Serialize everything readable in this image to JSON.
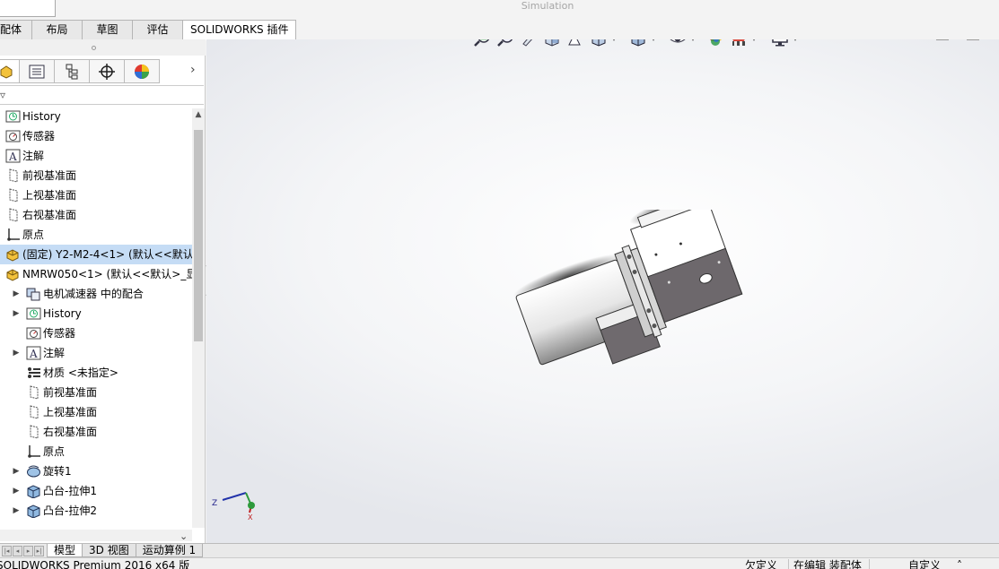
{
  "title_bar": {
    "simulation_label": "Simulation"
  },
  "ribbon": {
    "tabs": [
      {
        "label": "装配体",
        "display": "装配体"
      },
      {
        "label": "布局"
      },
      {
        "label": "草图"
      },
      {
        "label": "评估"
      },
      {
        "label": "SOLIDWORKS 插件",
        "active": true
      }
    ]
  },
  "feature_manager": {
    "panel_tabs": [
      "feature-manager-icon",
      "property-manager-icon",
      "configuration-manager-icon",
      "dimxpert-icon",
      "display-manager-icon"
    ],
    "tree": [
      {
        "label": "History",
        "icon": "history-icon",
        "level": 0,
        "expander": false
      },
      {
        "label": "传感器",
        "icon": "sensor-icon",
        "level": 0,
        "expander": false
      },
      {
        "label": "注解",
        "icon": "annotation-icon",
        "level": 0,
        "expander": false
      },
      {
        "label": "前视基准面",
        "icon": "plane-icon",
        "level": 0,
        "expander": false
      },
      {
        "label": "上视基准面",
        "icon": "plane-icon",
        "level": 0,
        "expander": false
      },
      {
        "label": "右视基准面",
        "icon": "plane-icon",
        "level": 0,
        "expander": false
      },
      {
        "label": "原点",
        "icon": "origin-icon",
        "level": 0,
        "expander": false
      },
      {
        "label": "(固定) Y2-M2-4<1> (默认<<默认",
        "icon": "part-icon",
        "level": 0,
        "expander": false,
        "selected": true
      },
      {
        "label": "NMRW050<1> (默认<<默认>_显",
        "icon": "part-icon",
        "level": 0,
        "expander": false
      },
      {
        "label": "电机减速器 中的配合",
        "icon": "mates-icon",
        "level": 1,
        "expander": true
      },
      {
        "label": "History",
        "icon": "history-icon",
        "level": 1,
        "expander": true
      },
      {
        "label": "传感器",
        "icon": "sensor-icon",
        "level": 1,
        "expander": false
      },
      {
        "label": "注解",
        "icon": "annotation-icon",
        "level": 1,
        "expander": true
      },
      {
        "label": "材质 <未指定>",
        "icon": "material-icon",
        "level": 1,
        "expander": false
      },
      {
        "label": "前视基准面",
        "icon": "plane-icon",
        "level": 1,
        "expander": false
      },
      {
        "label": "上视基准面",
        "icon": "plane-icon",
        "level": 1,
        "expander": false
      },
      {
        "label": "右视基准面",
        "icon": "plane-icon",
        "level": 1,
        "expander": false
      },
      {
        "label": "原点",
        "icon": "origin-icon",
        "level": 1,
        "expander": false
      },
      {
        "label": "旋转1",
        "icon": "revolve-icon",
        "level": 1,
        "expander": true
      },
      {
        "label": "凸台-拉伸1",
        "icon": "extrude-icon",
        "level": 1,
        "expander": true
      },
      {
        "label": "凸台-拉伸2",
        "icon": "extrude-icon",
        "level": 1,
        "expander": true
      }
    ]
  },
  "view_toolbar": {
    "buttons": [
      "zoom-to-fit-icon",
      "zoom-to-area-icon",
      "previous-view-icon",
      "section-view-icon",
      "dynamic-annotation-icon",
      "view-orientation-icon",
      "display-style-icon",
      "hide-show-items-icon",
      "edit-appearance-icon",
      "apply-scene-icon",
      "view-settings-icon"
    ]
  },
  "triad": {
    "z": "Z",
    "x": "X"
  },
  "bottom_tabs": [
    {
      "label": "模型",
      "active": true
    },
    {
      "label": "3D 视图"
    },
    {
      "label": "运动算例 1"
    }
  ],
  "status_bar": {
    "app": "SOLIDWORKS Premium 2016 x64 版",
    "definition": "欠定义",
    "editing": "在编辑 装配体",
    "custom": "自定义"
  }
}
